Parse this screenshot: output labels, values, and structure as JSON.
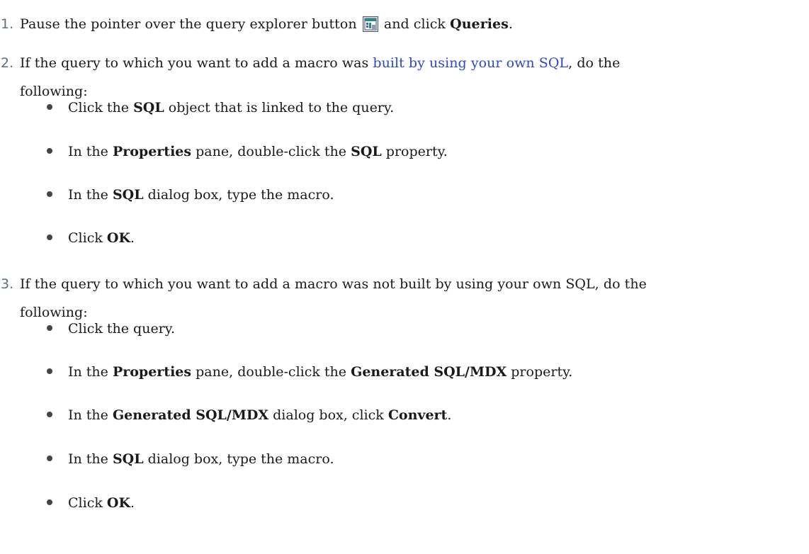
{
  "steps": [
    {
      "number": "1.",
      "pre": "Pause the pointer over the query explorer button",
      "icon": "query-explorer-icon",
      "mid": "and click",
      "bold": "Queries",
      "post": "."
    },
    {
      "number": "2.",
      "pre": "If the query to which you want to add a macro was",
      "link": "built by using your own SQL",
      "post_line1": ", do the",
      "line2": "following:",
      "bullets": [
        {
          "pre": "Click the",
          "b1": "SQL",
          "mid": "object that is linked to the query."
        },
        {
          "pre": "In the",
          "b1": "Properties",
          "mid": "pane, double-click the",
          "b2": "SQL",
          "post": "property."
        },
        {
          "pre": "In the",
          "b1": "SQL",
          "mid": "dialog box, type the macro."
        },
        {
          "pre": "Click",
          "b1": "OK",
          "mid": "."
        }
      ]
    },
    {
      "number": "3.",
      "line1": "If the query to which you want to add a macro was not built by using your own SQL, do the",
      "line2": "following:",
      "bullets": [
        {
          "pre": "Click the query."
        },
        {
          "pre": "In the",
          "b1": "Properties",
          "mid": "pane, double-click the",
          "b2": "Generated SQL/MDX",
          "post": "property."
        },
        {
          "pre": "In the",
          "b1": "Generated SQL/MDX",
          "mid": "dialog box, click",
          "b2": "Convert",
          "post": "."
        },
        {
          "pre": "In the",
          "b1": "SQL",
          "mid": "dialog box, type the macro."
        },
        {
          "pre": "Click",
          "b1": "OK",
          "mid": "."
        }
      ]
    }
  ],
  "colors": {
    "link": "#2d47c8",
    "number": "#5e6e7e",
    "text": "#1a1a1a"
  }
}
